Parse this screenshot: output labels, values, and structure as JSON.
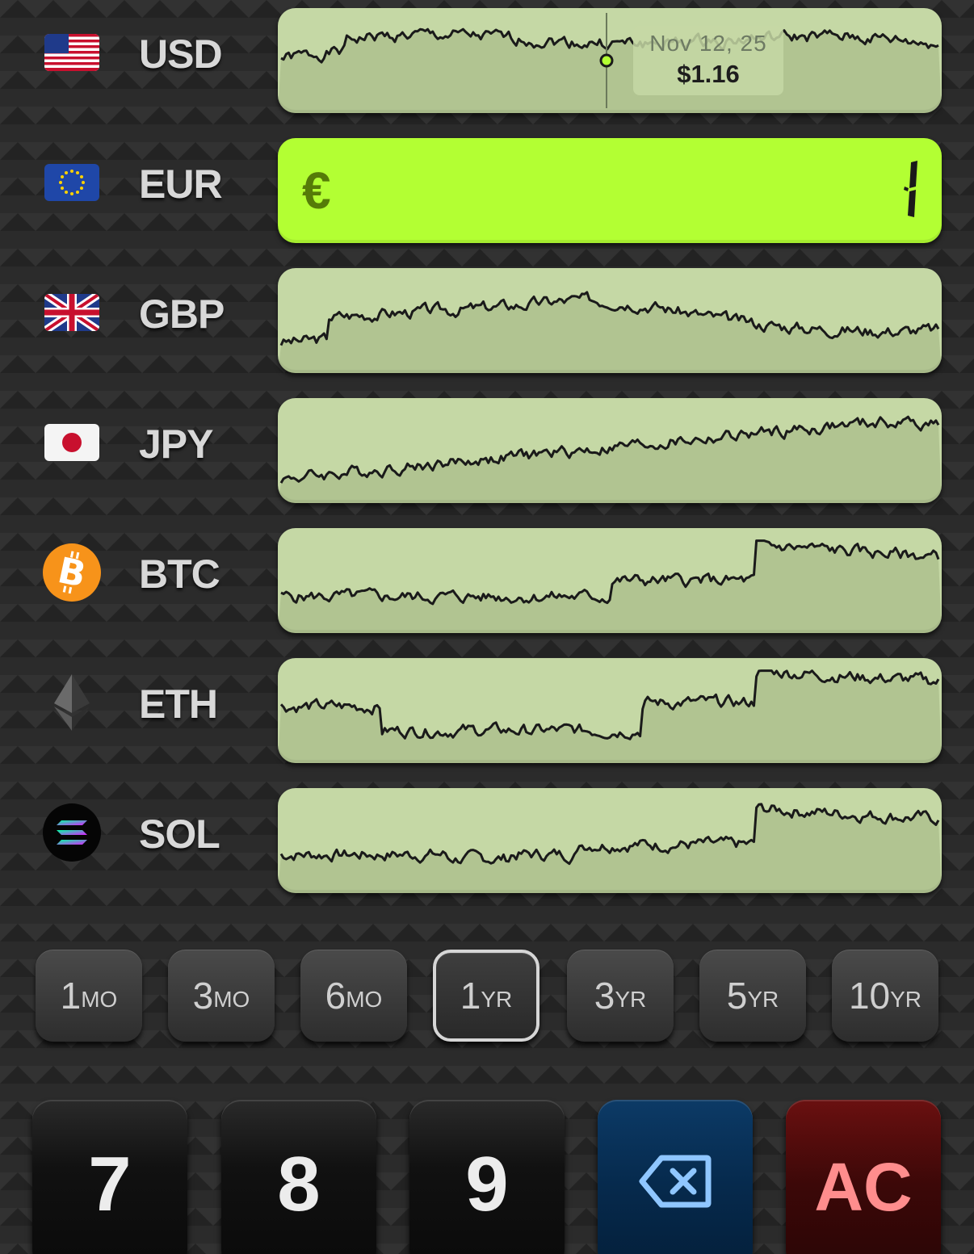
{
  "currencies": [
    {
      "code": "USD",
      "icon": "us-flag-icon"
    },
    {
      "code": "EUR",
      "icon": "eu-flag-icon"
    },
    {
      "code": "GBP",
      "icon": "uk-flag-icon"
    },
    {
      "code": "JPY",
      "icon": "japan-flag-icon"
    },
    {
      "code": "BTC",
      "icon": "bitcoin-icon"
    },
    {
      "code": "ETH",
      "icon": "ethereum-icon"
    },
    {
      "code": "SOL",
      "icon": "solana-icon"
    }
  ],
  "active_input": {
    "symbol": "€",
    "value": "1"
  },
  "tooltip": {
    "date": "Nov 12, 25",
    "price": "$1.16"
  },
  "ranges": [
    {
      "num": "1",
      "unit": "MO"
    },
    {
      "num": "3",
      "unit": "MO"
    },
    {
      "num": "6",
      "unit": "MO"
    },
    {
      "num": "1",
      "unit": "YR",
      "selected": true
    },
    {
      "num": "3",
      "unit": "YR"
    },
    {
      "num": "5",
      "unit": "YR"
    },
    {
      "num": "10",
      "unit": "YR"
    }
  ],
  "keypad": {
    "k7": "7",
    "k8": "8",
    "k9": "9",
    "backspace_icon": "backspace-icon",
    "ac": "AC"
  },
  "colors": {
    "chart_bg": "#c5d8a5",
    "active_bg": "#b3ff33",
    "line": "#1a1a1a"
  }
}
